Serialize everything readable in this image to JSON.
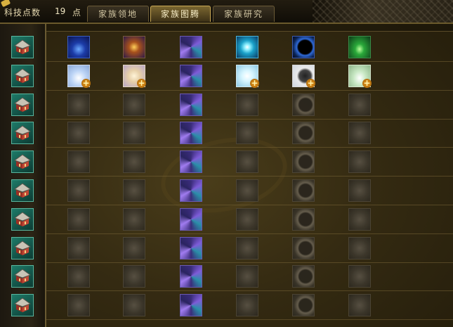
{
  "header": {
    "points_label": "科技点数",
    "points_value": "19",
    "points_unit": "点"
  },
  "tabs": [
    {
      "label": "家族领地",
      "active": false
    },
    {
      "label": "家族图腾",
      "active": true
    },
    {
      "label": "家族研究",
      "active": false
    }
  ],
  "grid": {
    "row_count": 10,
    "column_icons": [
      "blue-totem-icon",
      "cross-totem-icon",
      "swirl-totem-icon",
      "star-totem-icon",
      "eclipse-totem-icon",
      "green-totem-icon"
    ],
    "rows": [
      {
        "state": [
          "unlocked",
          "unlocked",
          "unlocked",
          "unlocked",
          "unlocked",
          "unlocked"
        ]
      },
      {
        "state": [
          "upgradable",
          "upgradable",
          "unlocked",
          "upgradable",
          "upgradable",
          "upgradable"
        ]
      },
      {
        "state": [
          "locked",
          "locked",
          "unlocked",
          "locked",
          "locked",
          "locked"
        ]
      },
      {
        "state": [
          "locked",
          "locked",
          "unlocked",
          "locked",
          "locked",
          "locked"
        ]
      },
      {
        "state": [
          "locked",
          "locked",
          "unlocked",
          "locked",
          "locked",
          "locked"
        ]
      },
      {
        "state": [
          "locked",
          "locked",
          "unlocked",
          "locked",
          "locked",
          "locked"
        ]
      },
      {
        "state": [
          "locked",
          "locked",
          "unlocked",
          "locked",
          "locked",
          "locked"
        ]
      },
      {
        "state": [
          "locked",
          "locked",
          "unlocked",
          "locked",
          "locked",
          "locked"
        ]
      },
      {
        "state": [
          "locked",
          "locked",
          "unlocked",
          "locked",
          "locked",
          "locked"
        ]
      },
      {
        "state": [
          "locked",
          "locked",
          "unlocked",
          "locked",
          "locked",
          "locked"
        ]
      }
    ]
  },
  "colors": {
    "accent": "#c9a855",
    "frame": "#6a5a32",
    "building_icon": "#1e7a68"
  }
}
